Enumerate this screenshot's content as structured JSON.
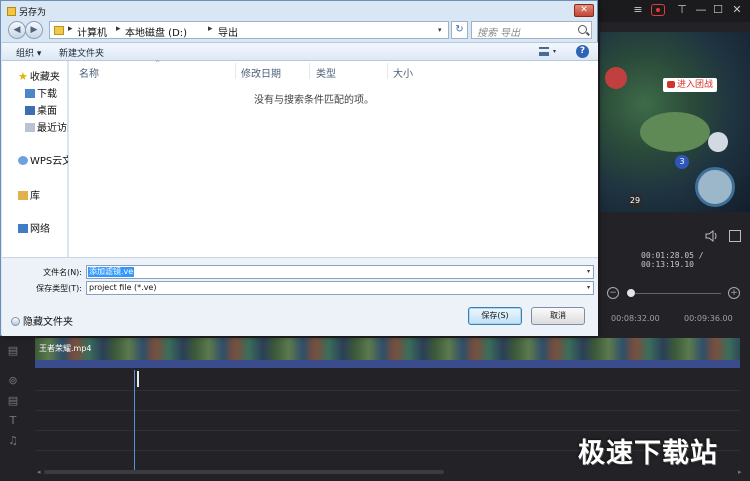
{
  "editor": {
    "time_readout": "00:01:28.05 / 00:13:19.10",
    "preview_label": "进入团战",
    "preview_numbers": [
      "3",
      "29"
    ],
    "ruler_ticks": [
      "00:08:32.00",
      "00:09:36.00"
    ],
    "clip_name": "王者荣耀.mp4",
    "watermark": "极速下载站"
  },
  "dialog": {
    "title": "另存为",
    "close_label": "✕",
    "breadcrumbs": [
      "计算机",
      "本地磁盘 (D:)",
      "导出"
    ],
    "search_placeholder": "搜索 导出",
    "toolbar": {
      "organize": "组织 ▾",
      "new_folder": "新建文件夹",
      "help": "?"
    },
    "nav_items": {
      "favorites": "收藏夹",
      "downloads": "下载",
      "desktop": "桌面",
      "recent": "最近访问的位置",
      "wps_cloud": "WPS云文档",
      "libraries": "库",
      "network": "网络"
    },
    "columns": [
      "名称",
      "修改日期",
      "类型",
      "大小"
    ],
    "empty_message": "没有与搜索条件匹配的项。",
    "filename_label": "文件名(N):",
    "filename_value": "添加滤镜.ve",
    "filetype_label": "保存类型(T):",
    "filetype_value": "project file (*.ve)",
    "hide_folders": "隐藏文件夹",
    "save_button": "保存(S)",
    "cancel_button": "取消"
  }
}
